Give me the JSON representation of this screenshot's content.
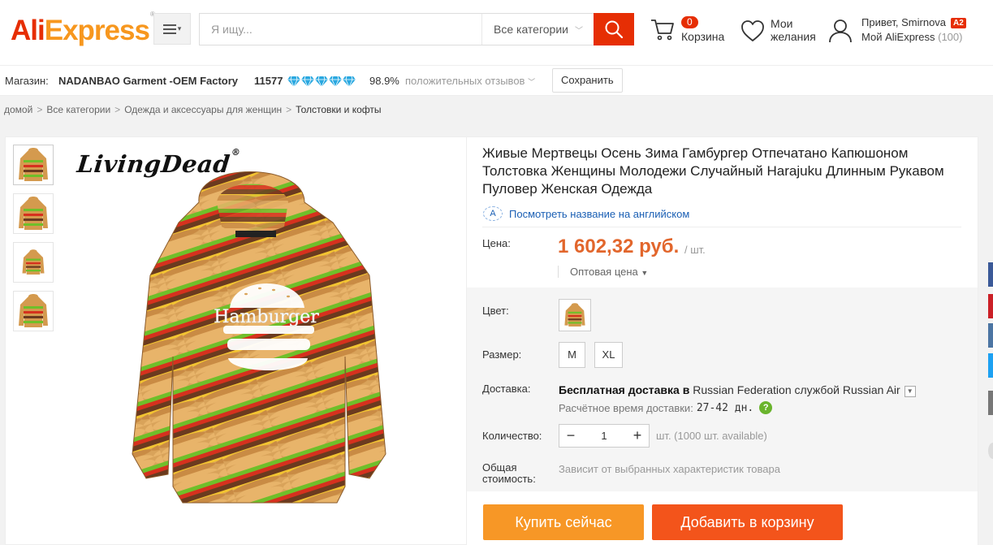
{
  "header": {
    "logo_main": "Ali",
    "logo_rest": "Express",
    "logo_mark": "®",
    "search_placeholder": "Я ищу...",
    "category_select": "Все категории",
    "cart_count": "0",
    "cart_label": "Корзина",
    "wishlist_line1": "Мои",
    "wishlist_line2": "желания",
    "account_greeting": "Привет, Smirnova",
    "account_level": "A2",
    "account_link": "Мой AliExpress",
    "account_count": "(100)"
  },
  "store": {
    "label": "Магазин:",
    "name": "NADANBAO Garment -OEM Factory",
    "score": "11577",
    "diamonds": 5,
    "positive_pct": "98.9%",
    "feedback_label": "положительных отзывов",
    "save_label": "Сохранить"
  },
  "breadcrumb": {
    "items": [
      "домой",
      "Все категории",
      "Одежда и аксессуары для женщин"
    ],
    "current": "Толстовки и кофты",
    "separator": ">"
  },
  "gallery": {
    "brand": "LivingDead",
    "brand_mark": "®",
    "image_text": "Hamburger",
    "thumbnail_count": 4
  },
  "product": {
    "title": "Живые Мертвецы Осень Зима Гамбургер Отпечатано Капюшоном Толстовка Женщины Молодежи Случайный Harajuku Длинным Рукавом Пуловер Женская Одежда",
    "translate_icon": "A",
    "translate_link": "Посмотреть название на английском",
    "price_label": "Цена:",
    "price": "1 602,32 руб.",
    "price_unit": "/ шт.",
    "wholesale": "Оптовая цена",
    "color_label": "Цвет:",
    "size_label": "Размер:",
    "sizes": [
      "M",
      "XL"
    ],
    "shipping_label": "Доставка:",
    "shipping_free": "Бесплатная доставка в",
    "shipping_country": "Russian Federation",
    "shipping_via": "службой",
    "shipping_service": "Russian Air",
    "delivery_label": "Расчётное время доставки:",
    "delivery_days": "27-42 дн.",
    "quantity_label": "Количество:",
    "quantity_value": "1",
    "quantity_note": "шт. (1000 шт. available)",
    "total_label_1": "Общая",
    "total_label_2": "стоимость:",
    "total_value": "Зависит от выбранных характеристик товара",
    "buy_now": "Купить сейчас",
    "add_to_cart": "Добавить в корзину"
  },
  "colors": {
    "brand_red": "#e62e04",
    "price": "#e2662c",
    "buy_now": "#f79726",
    "add_to_cart": "#f3541b",
    "link": "#1a5fb4",
    "diamond": "#2aa8e0"
  }
}
